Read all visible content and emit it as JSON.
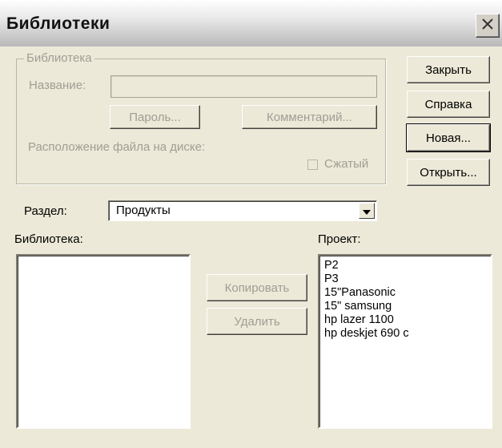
{
  "window": {
    "title": "Библиотеки"
  },
  "library_group": {
    "legend": "Библиотека",
    "name_label": "Название:",
    "name_value": "",
    "password_button": "Пароль...",
    "comment_button": "Комментарий...",
    "location_label": "Расположение файла на диске:",
    "compressed_label": "Сжатый",
    "compressed_checked": false
  },
  "buttons": {
    "close": "Закрыть",
    "help": "Справка",
    "new": "Новая...",
    "open": "Открыть..."
  },
  "section": {
    "label": "Раздел:",
    "selected": "Продукты"
  },
  "library_list": {
    "label": "Библиотека:",
    "items": []
  },
  "actions": {
    "copy": "Копировать",
    "delete": "Удалить"
  },
  "project_list": {
    "label": "Проект:",
    "items": [
      "P2",
      "P3",
      "15\"Panasonic",
      "15\" samsung",
      "hp lazer 1100",
      "hp deskjet 690 c"
    ]
  }
}
